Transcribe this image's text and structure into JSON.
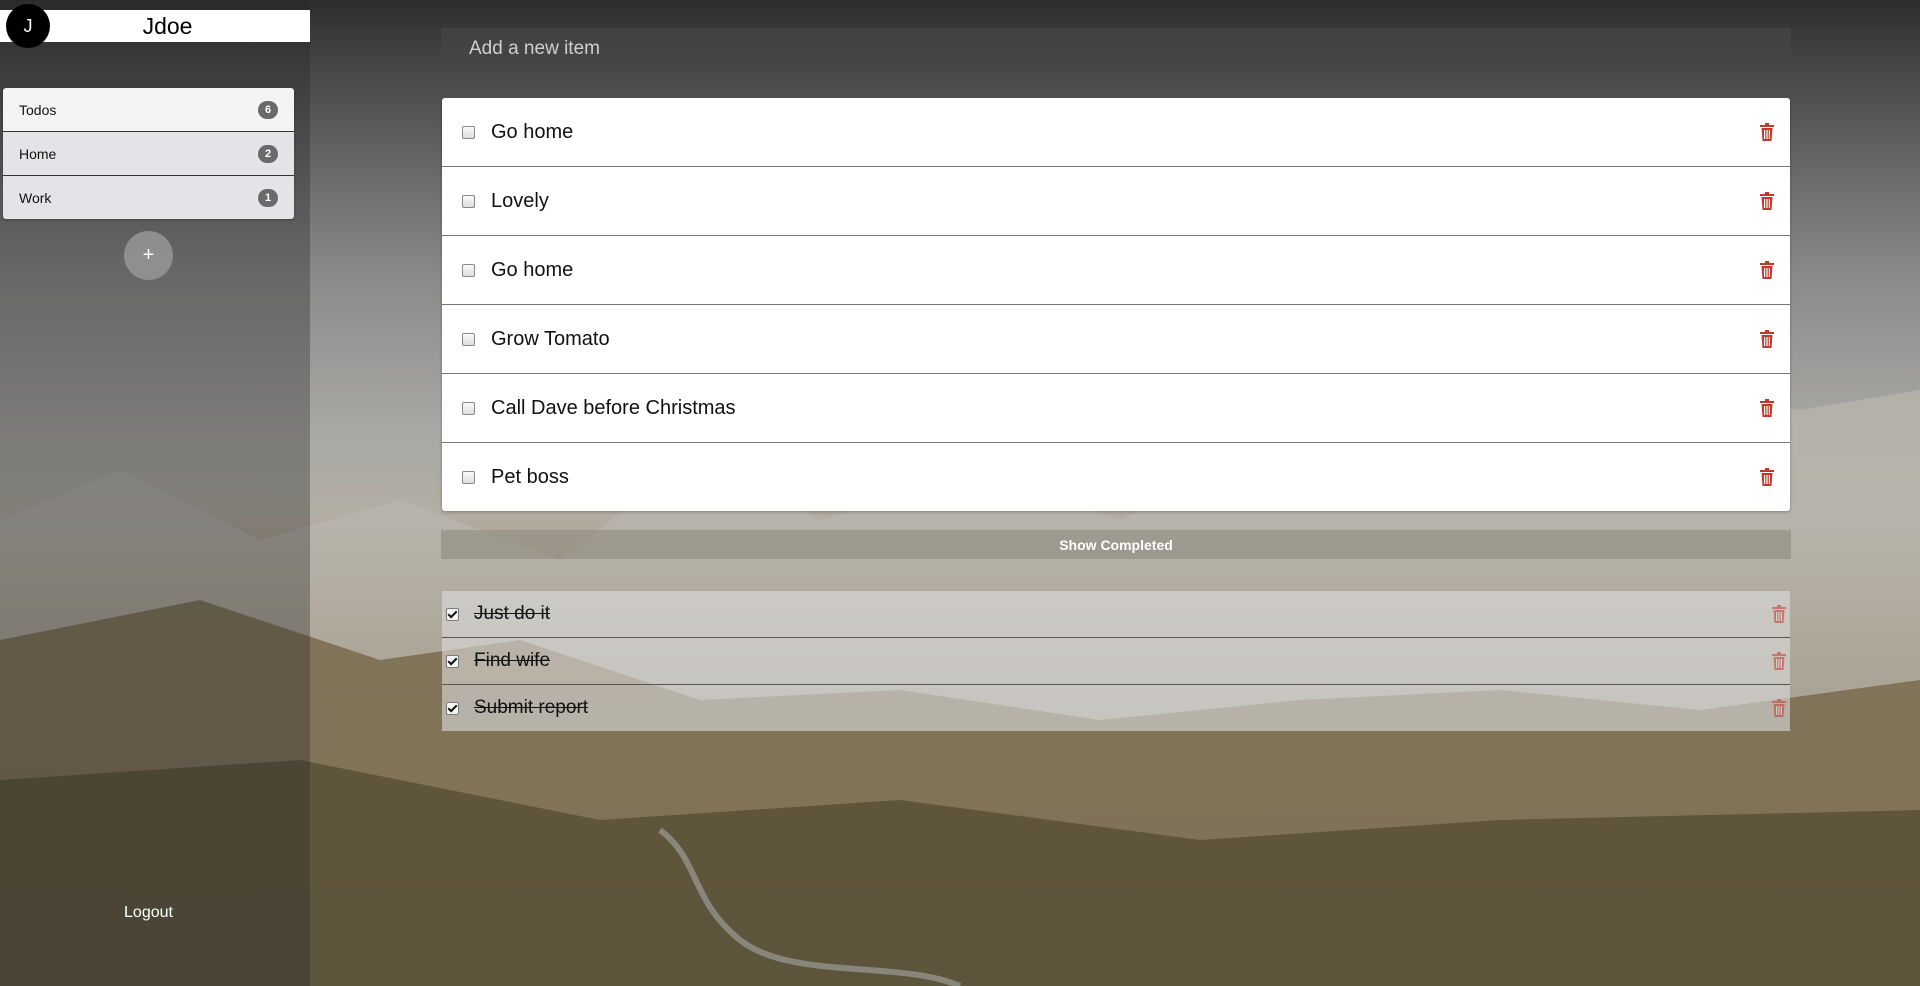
{
  "user": {
    "avatar_initial": "J",
    "name": "Jdoe"
  },
  "sidebar": {
    "lists": [
      {
        "label": "Todos",
        "count": "6",
        "active": true
      },
      {
        "label": "Home",
        "count": "2",
        "active": false
      },
      {
        "label": "Work",
        "count": "1",
        "active": false
      }
    ],
    "add_list_label": "+",
    "logout_label": "Logout"
  },
  "main": {
    "new_item_placeholder": "Add a new item",
    "todos": [
      "Go home",
      "Lovely",
      "Go home",
      "Grow Tomato",
      "Call Dave before Christmas",
      "Pet boss"
    ],
    "show_completed_label": "Show Completed",
    "completed": [
      "Just do it",
      "Find wife",
      "Submit report"
    ]
  },
  "colors": {
    "trash_icon": "#c0392b",
    "sidebar_active": "#f4f4f4",
    "sidebar_item": "#e4e3e8",
    "badge": "#6a6a6a"
  },
  "icons": {
    "trash": "trash-icon",
    "checkbox": "checkbox-icon",
    "add": "plus-icon"
  }
}
